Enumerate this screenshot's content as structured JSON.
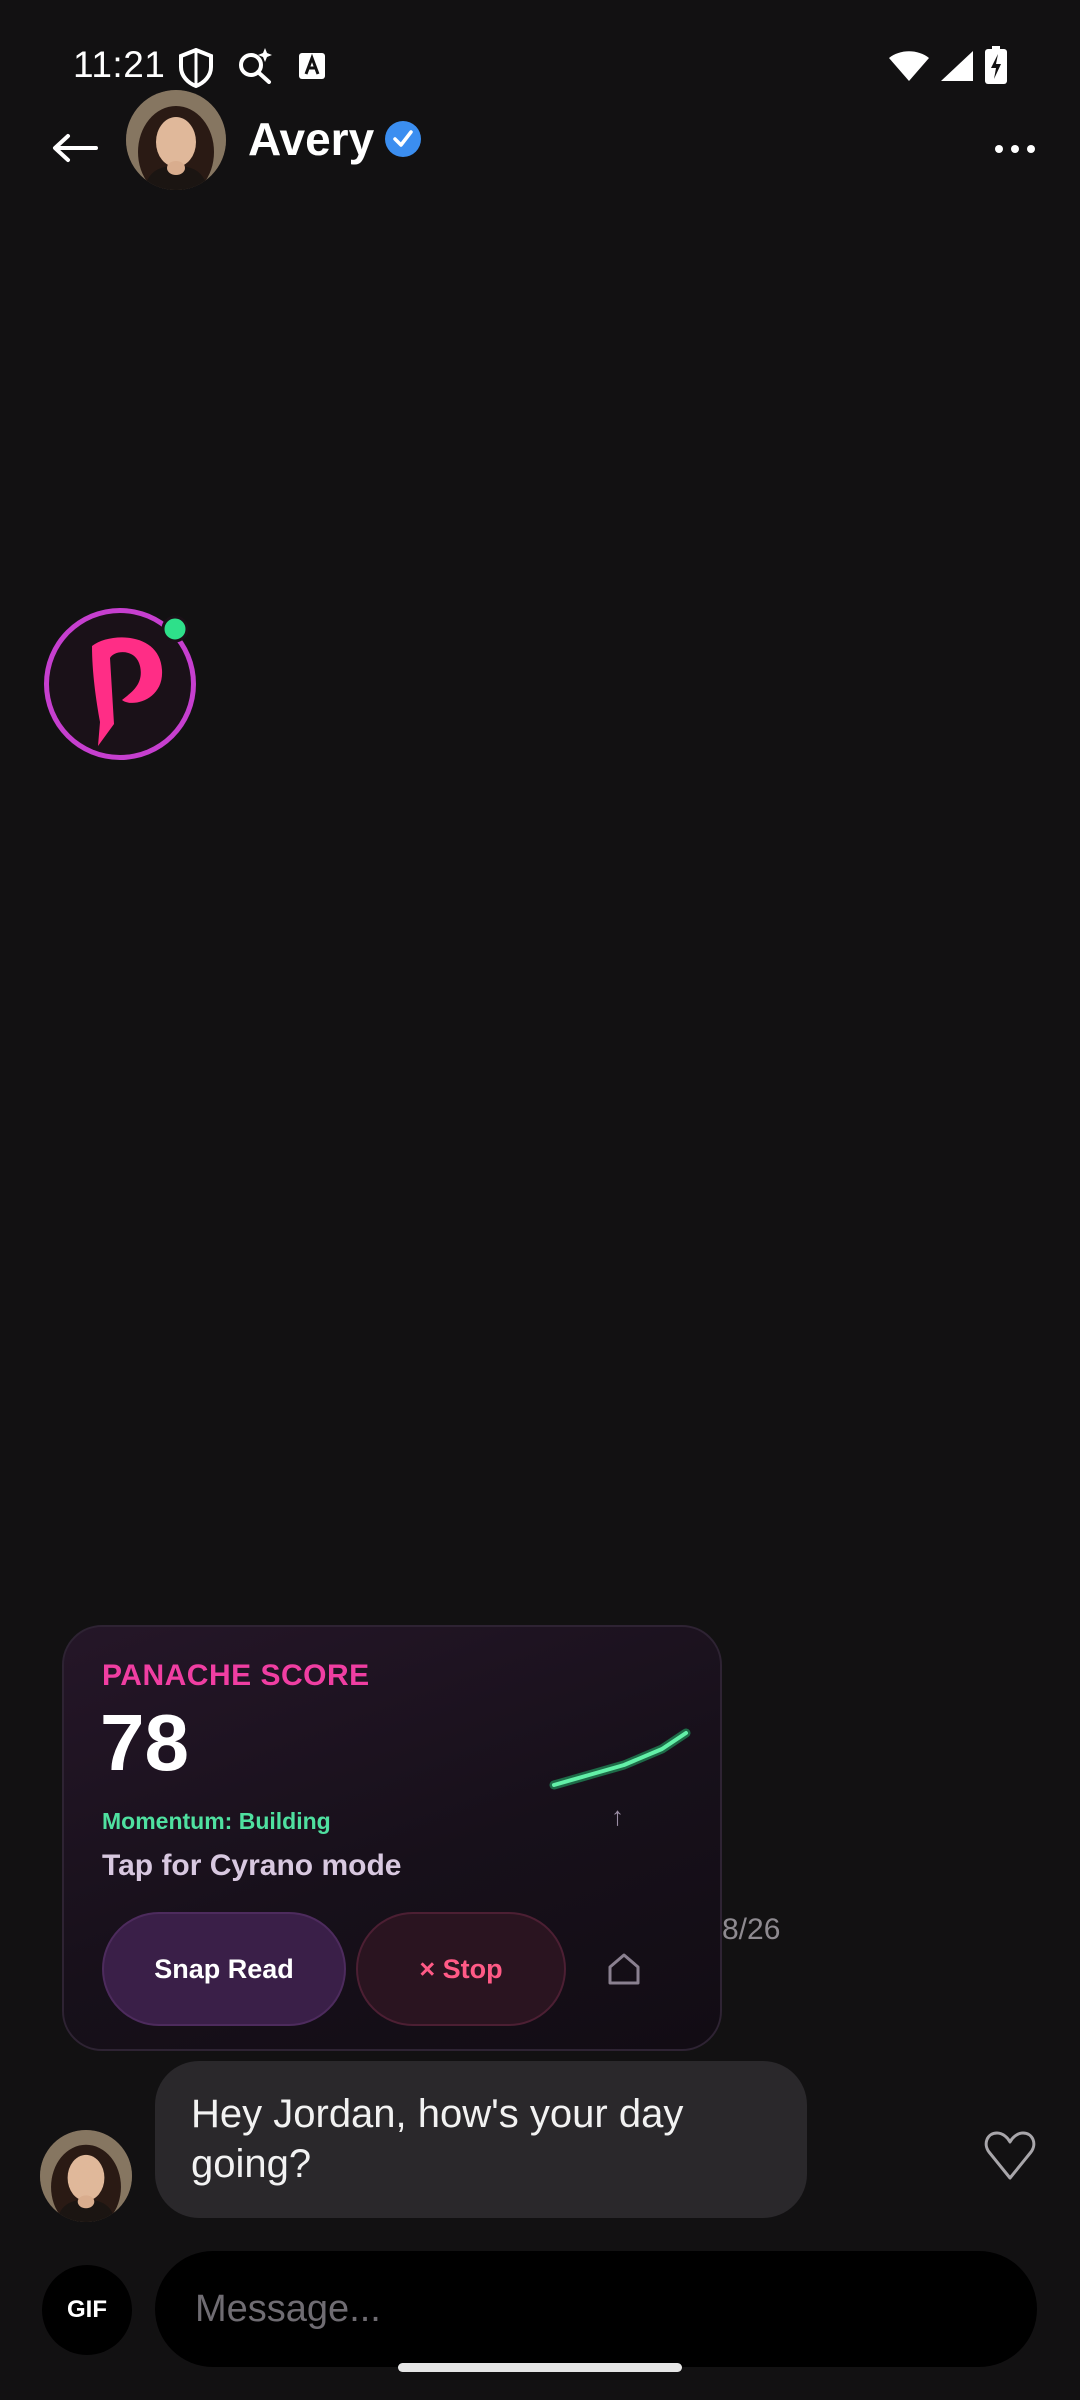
{
  "status_bar": {
    "time": "11:21",
    "icons": [
      "shield-icon",
      "search-sparkle-icon",
      "a-icon",
      "wifi-icon",
      "signal-icon",
      "battery-charging-icon"
    ]
  },
  "header": {
    "back_icon": "back-arrow-icon",
    "name": "Avery",
    "verified": true,
    "more_icon": "more-horizontal-icon"
  },
  "panache": {
    "title": "PANACHE SCORE",
    "score": "78",
    "momentum": "Momentum: Building",
    "subtitle": "Tap for Cyrano mode",
    "trend_arrow": "↑",
    "snap_read_label": "Snap Read",
    "stop_label": "× Stop",
    "home_icon": "home-icon"
  },
  "thread": {
    "date": "8/26",
    "message": "Hey Jordan, how's your day going?"
  },
  "composer": {
    "gif_label": "GIF",
    "placeholder": "Message..."
  },
  "colors": {
    "background": "#121112",
    "accent_pink": "#f03ea2",
    "momentum_green": "#4fe0a0",
    "verified_blue": "#3b8ef0",
    "stop_red": "#ff5a86"
  }
}
